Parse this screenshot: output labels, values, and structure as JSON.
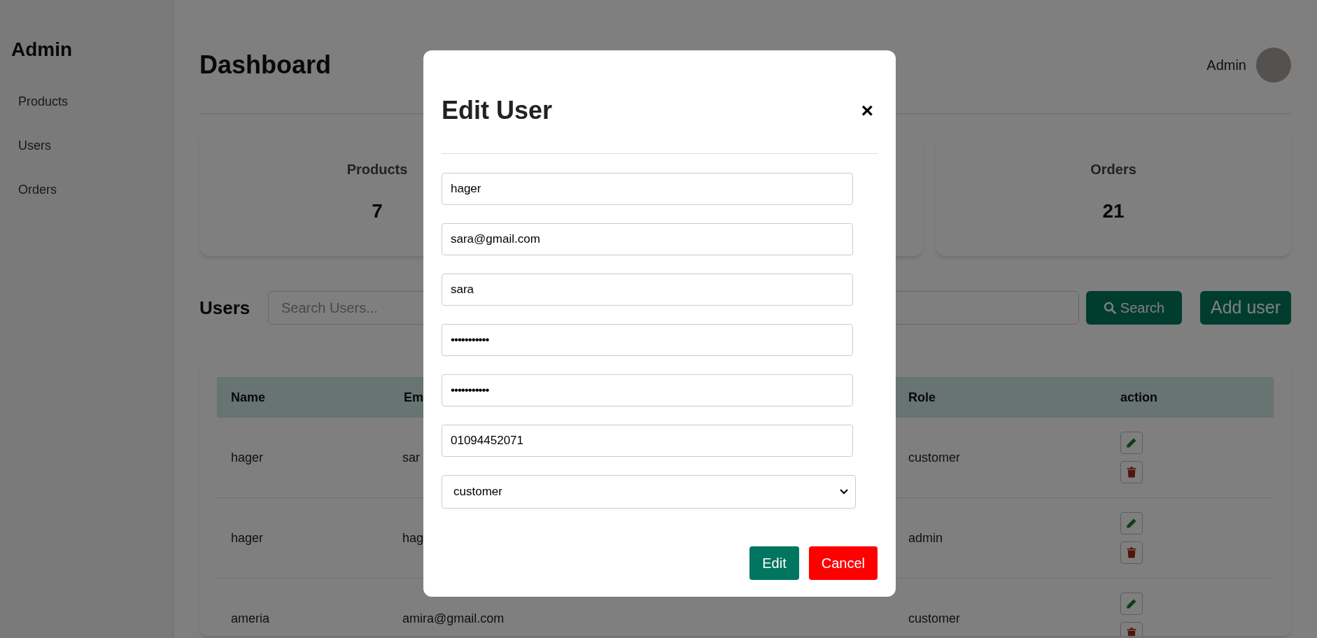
{
  "sidebar": {
    "title": "Admin",
    "items": [
      {
        "label": "Products"
      },
      {
        "label": "Users"
      },
      {
        "label": "Orders"
      }
    ]
  },
  "header": {
    "title": "Dashboard",
    "user_name": "Admin"
  },
  "stat_cards": [
    {
      "label": "Products",
      "value": "7"
    },
    {
      "label": "Orders",
      "value": "21"
    }
  ],
  "users_section": {
    "title": "Users",
    "search": {
      "placeholder": "Search Users..."
    },
    "search_button": "Search",
    "add_button": "Add user"
  },
  "table": {
    "columns": [
      "Name",
      "Em",
      "",
      "Role",
      "action"
    ],
    "rows": [
      {
        "name": "hager",
        "email": "sar",
        "role": "customer"
      },
      {
        "name": "hager",
        "email": "hag",
        "role": "admin"
      },
      {
        "name": "ameria",
        "email": "amira@gmail.com",
        "role": "customer"
      }
    ]
  },
  "modal": {
    "title": "Edit User",
    "close": "×",
    "fields": [
      {
        "kind": "text",
        "value": "hager"
      },
      {
        "kind": "text",
        "value": "sara@gmail.com"
      },
      {
        "kind": "text",
        "value": "sara"
      },
      {
        "kind": "password",
        "value": "•••••••••••"
      },
      {
        "kind": "password",
        "value": "•••••••••••"
      },
      {
        "kind": "text",
        "value": "01094452071"
      },
      {
        "kind": "select",
        "value": "customer"
      }
    ],
    "buttons": [
      {
        "kind": "primary",
        "label": "Edit"
      },
      {
        "kind": "danger",
        "label": "Cancel"
      }
    ]
  }
}
